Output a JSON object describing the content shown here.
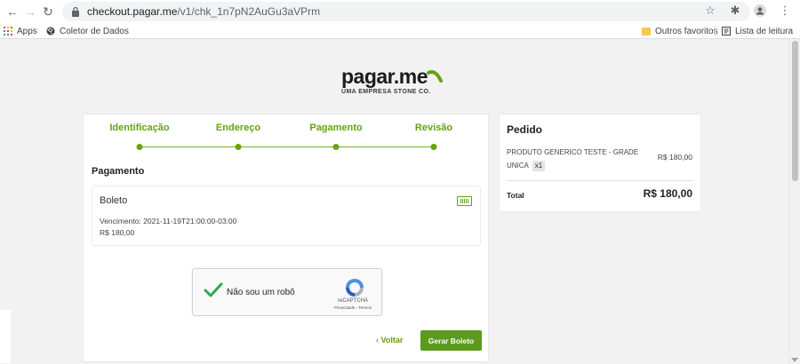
{
  "browser": {
    "url_host": "checkout.pagar.me",
    "url_path": "/v1/chk_1n7pN2AuGu3aVPrm",
    "bookmarks": {
      "apps": "Apps",
      "coletor": "Coletor de Dados",
      "outros": "Outros favoritos",
      "lista": "Lista de leitura"
    }
  },
  "brand": {
    "logo": "pagar.me",
    "tagline": "UMA EMPRESA STONE CO.",
    "swoosh_color": "#65a30d"
  },
  "steps": [
    {
      "label": "Identificação"
    },
    {
      "label": "Endereço"
    },
    {
      "label": "Pagamento"
    },
    {
      "label": "Revisão"
    }
  ],
  "payment": {
    "section_title": "Pagamento",
    "method": "Boleto",
    "due": "Vencimento: 2021-11-19T21:00:00-03:00",
    "amount": "R$ 180,00",
    "icon": "barcode-icon"
  },
  "captcha": {
    "label": "Não sou um robô",
    "brand": "reCAPTCHA",
    "links": "Privacidade - Termos"
  },
  "actions": {
    "back": "‹ Voltar",
    "submit": "Gerar Boleto"
  },
  "order": {
    "title": "Pedido",
    "product": "PRODUTO GENERICO TESTE - GRADE UNICA",
    "qty": "x1",
    "price": "R$ 180,00",
    "total_label": "Total",
    "total_value": "R$ 180,00"
  },
  "colors": {
    "accent": "#65a30d",
    "button": "#5b9a1f"
  }
}
